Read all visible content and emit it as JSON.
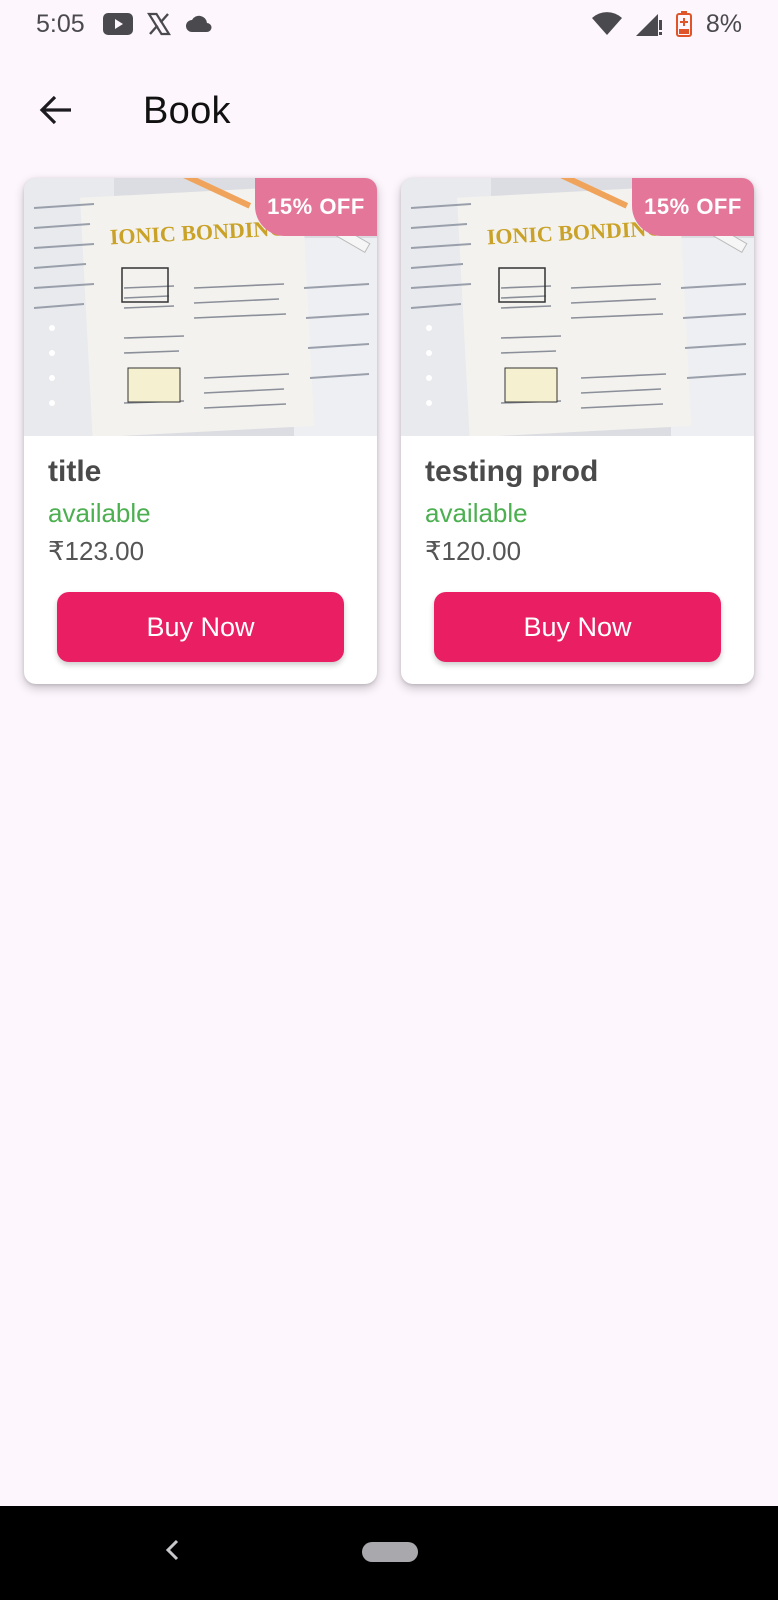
{
  "status_bar": {
    "time": "5:05",
    "battery_percent": "8%",
    "icons_left": [
      "youtube-icon",
      "x-icon",
      "cloud-icon"
    ],
    "icons_right": [
      "wifi-icon",
      "signal-icon",
      "battery-icon"
    ]
  },
  "app_bar": {
    "title": "Book",
    "back_icon": "arrow-left-icon"
  },
  "products": [
    {
      "title": "title",
      "status": "available",
      "price": "₹123.00",
      "discount": "15% OFF",
      "button_label": "Buy Now",
      "image_text": "IONIC BONDING"
    },
    {
      "title": "testing prod",
      "status": "available",
      "price": "₹120.00",
      "discount": "15% OFF",
      "button_label": "Buy Now",
      "image_text": "IONIC BONDING"
    }
  ],
  "colors": {
    "background": "#fdf6fd",
    "accent": "#e91e63",
    "badge": "#e4769a",
    "available": "#4caf50"
  },
  "nav_bar": {
    "back_icon": "chevron-left-icon",
    "home_icon": "home-pill-icon"
  }
}
